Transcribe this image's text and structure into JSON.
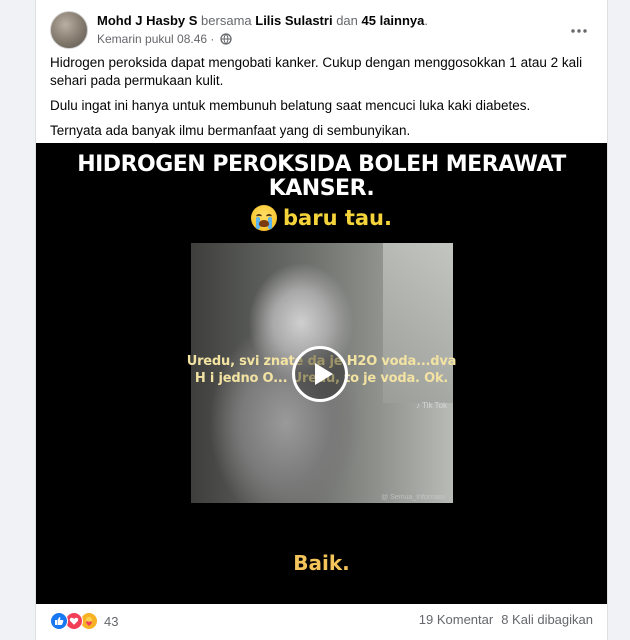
{
  "post": {
    "author": "Mohd J Hasby S",
    "with_word": "bersama",
    "tagged_person": "Lilis Sulastri",
    "and_word": "dan",
    "others": "45 lainnya",
    "period": ".",
    "timestamp": "Kemarin pukul 08.46",
    "dot": "·",
    "privacy_icon": "globe-icon",
    "more_icon": "more-options-icon",
    "paragraphs": [
      "Hidrogen peroksida dapat mengobati kanker. Cukup dengan menggosokkan 1 atau 2 kali sehari pada permukaan kulit.",
      "Dulu ingat ini hanya untuk membunuh belatung saat mencuci luka kaki diabetes.",
      "Ternyata ada banyak ilmu bermanfaat yang di sembunyikan."
    ]
  },
  "video": {
    "headline_line1": "HIDROGEN PEROKSIDA BOLEH MERAWAT",
    "headline_line2": "KANSER.",
    "sub_headline": "baru tau.",
    "sub_emoji": "crying-face-emoji",
    "subtitle_line1": "Uredu, svi znate da je H2O voda...dva",
    "subtitle_line2": "H i jedno O... Uredu, to je voda. Ok.",
    "watermark": "♪ Tik Tok",
    "watermark2": "@ Semua_Informasi",
    "bottom_caption": "Baik.",
    "play_icon": "play-icon"
  },
  "footer": {
    "reactions": [
      "like-icon",
      "love-icon",
      "care-icon"
    ],
    "reaction_count": "43",
    "comments": "19 Komentar",
    "shares": "8 Kali dibagikan"
  }
}
